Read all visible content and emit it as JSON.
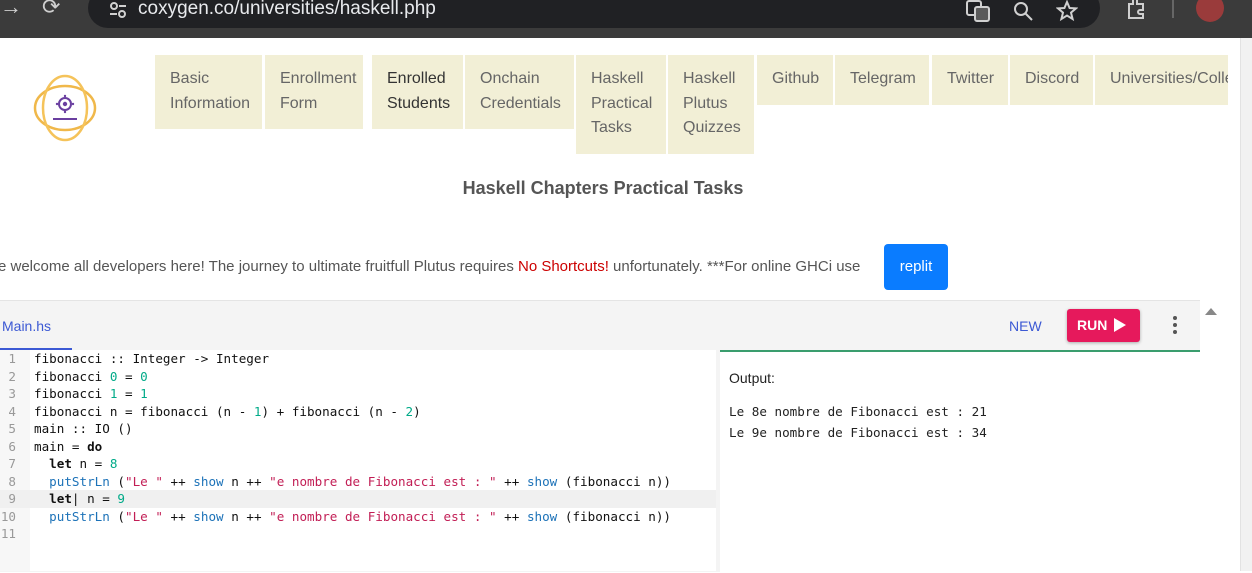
{
  "browser": {
    "url": "coxygen.co/universities/haskell.php",
    "back_glyph": "→",
    "reload_glyph": "⟳"
  },
  "logo": {
    "alt": "Coxygen Global"
  },
  "nav": [
    {
      "label": "Basic\nInformation"
    },
    {
      "label": "Enrollment\nForm"
    },
    {
      "label": "Enrolled\nStudents"
    },
    {
      "label": "Onchain\nCredentials"
    },
    {
      "label": "Haskell\nPractical\nTasks"
    },
    {
      "label": "Haskell\nPlutus\nQuizzes"
    },
    {
      "label": "Github"
    },
    {
      "label": "Telegram"
    },
    {
      "label": "Twitter"
    },
    {
      "label": "Discord"
    },
    {
      "label": "Universities/Colle"
    }
  ],
  "page": {
    "title": "Haskell Chapters Practical Tasks",
    "welcome_prefix": "e welcome all developers here! The journey to ultimate fruitfull Plutus requires ",
    "welcome_warning": "No Shortcuts!",
    "welcome_suffix": " unfortunately. ***For online GHCi use",
    "replit_label": "replit"
  },
  "editor": {
    "file_tab": "Main.hs",
    "new_label": "NEW",
    "run_label": "RUN",
    "line_numbers": [
      "1",
      "2",
      "3",
      "4",
      "5",
      "6",
      "7",
      "8",
      "9",
      "10",
      "11"
    ],
    "output_label": "Output:",
    "output_lines": [
      "Le 8e nombre de Fibonacci est : 21",
      "Le 9e nombre de Fibonacci est : 34"
    ]
  },
  "colors": {
    "nav_bg": "#f2efd6",
    "run_button": "#e6195c",
    "replit_button": "#0a7cff",
    "link_blue": "#3c59d4",
    "warning_red": "#cc0000"
  }
}
